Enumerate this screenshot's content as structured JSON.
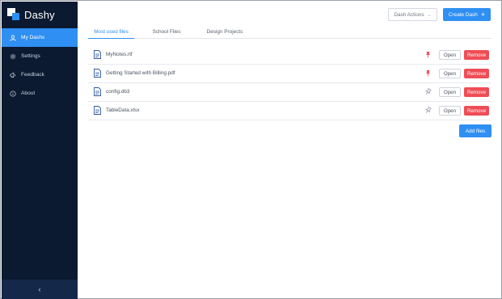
{
  "app": {
    "name": "Dashy"
  },
  "sidebar": {
    "items": [
      {
        "label": "My Dashs",
        "icon": "user-icon",
        "active": true
      },
      {
        "label": "Settings",
        "icon": "gear-icon",
        "active": false
      },
      {
        "label": "Feedback",
        "icon": "megaphone-icon",
        "active": false
      },
      {
        "label": "About",
        "icon": "info-icon",
        "active": false
      }
    ],
    "collapse_icon": "chevron-left-icon",
    "collapse_glyph": "‹"
  },
  "toolbar": {
    "dash_actions_label": "Dash Actions",
    "create_dash_label": "Create Dash",
    "create_dash_glyph": "+"
  },
  "tabs": [
    {
      "label": "Most used files",
      "active": true
    },
    {
      "label": "School Files",
      "active": false
    },
    {
      "label": "Design Projects",
      "active": false
    }
  ],
  "files": [
    {
      "name": "MyNotes.rtf",
      "pinned": true
    },
    {
      "name": "Getting Started with Billing.pdf",
      "pinned": true
    },
    {
      "name": "config.db3",
      "pinned": false
    },
    {
      "name": "TableData.xlsx",
      "pinned": false
    }
  ],
  "file_actions": {
    "open_label": "Open",
    "remove_label": "Remove"
  },
  "add_files_label": "Add files",
  "colors": {
    "sidebar_bg": "#0b1a30",
    "accent": "#2f8ff2",
    "danger": "#ef4d56",
    "pin_active": "#ef4d56",
    "pin_inactive": "#8a929e"
  }
}
